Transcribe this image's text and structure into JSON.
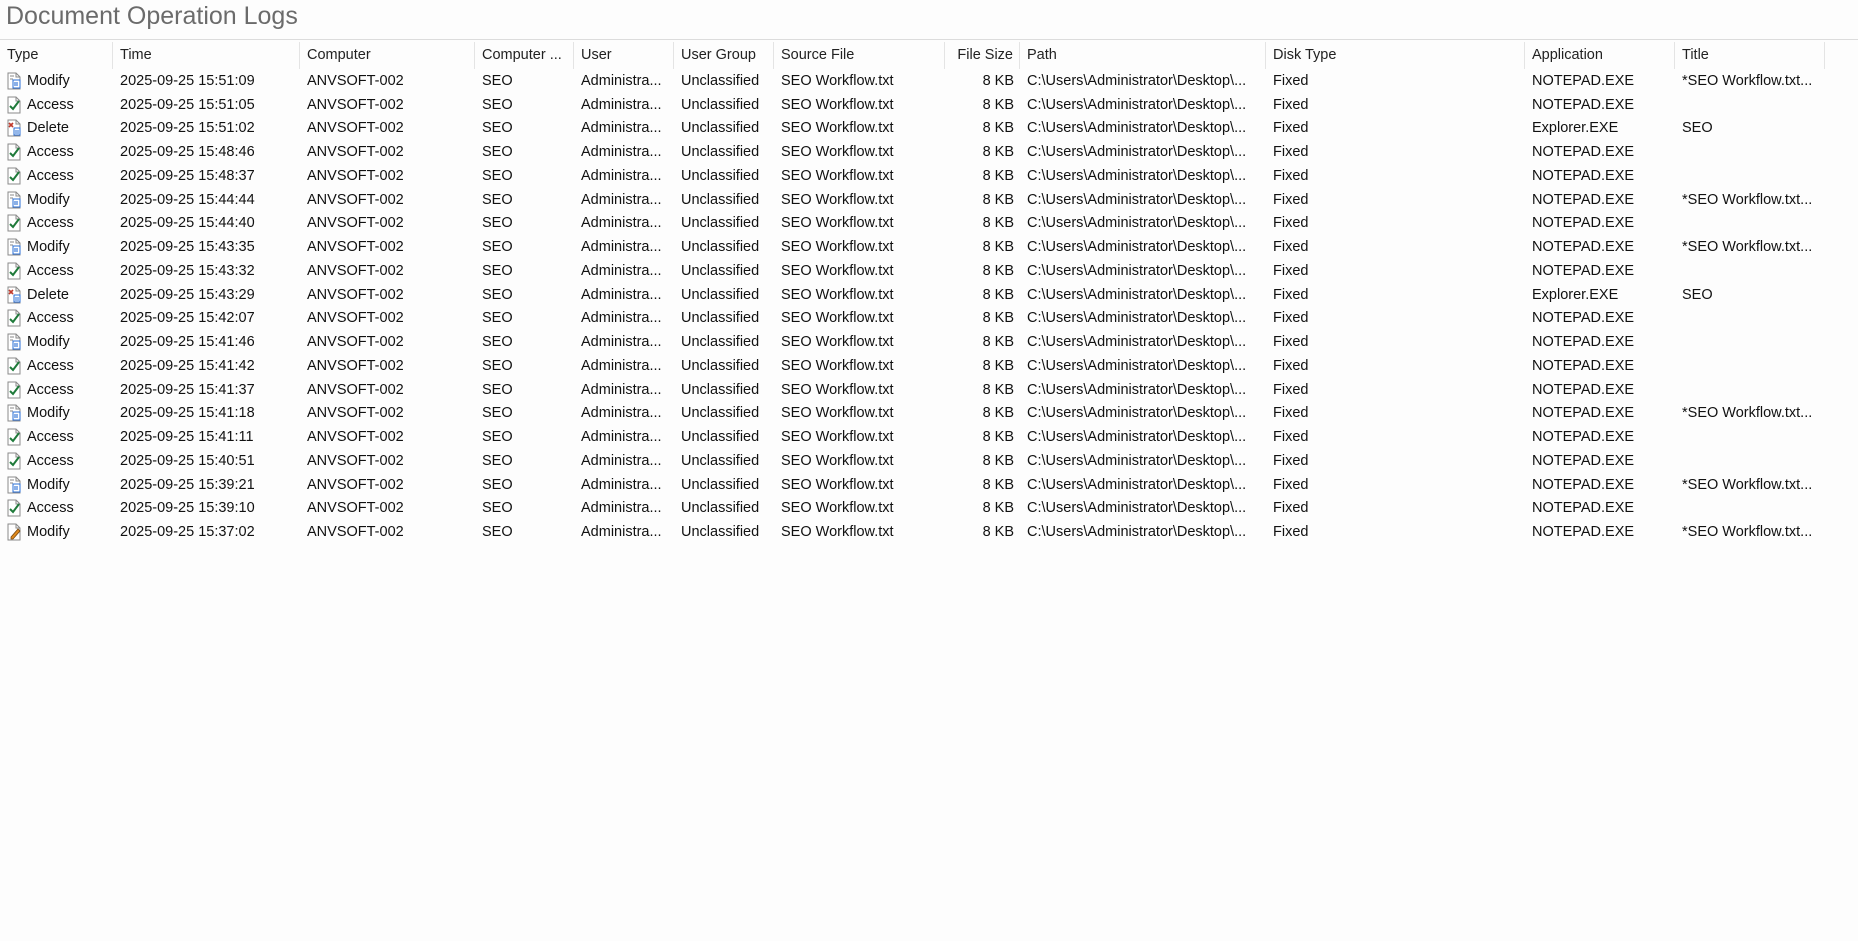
{
  "page_title": "Document Operation Logs",
  "columns": {
    "type": "Type",
    "time": "Time",
    "computer": "Computer",
    "computer_group": "Computer ...",
    "user": "User",
    "user_group": "User Group",
    "source_file": "Source File",
    "file_size": "File Size",
    "path": "Path",
    "disk_type": "Disk Type",
    "application": "Application",
    "title": "Title"
  },
  "icons": {
    "Modify": "modify-icon",
    "Access": "access-icon",
    "Delete": "delete-icon"
  },
  "colors": {
    "check": "#1f7a3a",
    "delete_red": "#c0392b",
    "modify_blue": "#2a6fd6",
    "pencil": "#e08a1e"
  },
  "rows": [
    {
      "type": "Modify",
      "time": "2025-09-25 15:51:09",
      "computer": "ANVSOFT-002",
      "group": "SEO",
      "user": "Administra...",
      "ugroup": "Unclassified",
      "src": "SEO Workflow.txt",
      "size": "8 KB",
      "path": "C:\\Users\\Administrator\\Desktop\\...",
      "disk": "Fixed",
      "app": "NOTEPAD.EXE",
      "title": "*SEO Workflow.txt..."
    },
    {
      "type": "Access",
      "time": "2025-09-25 15:51:05",
      "computer": "ANVSOFT-002",
      "group": "SEO",
      "user": "Administra...",
      "ugroup": "Unclassified",
      "src": "SEO Workflow.txt",
      "size": "8 KB",
      "path": "C:\\Users\\Administrator\\Desktop\\...",
      "disk": "Fixed",
      "app": "NOTEPAD.EXE",
      "title": ""
    },
    {
      "type": "Delete",
      "time": "2025-09-25 15:51:02",
      "computer": "ANVSOFT-002",
      "group": "SEO",
      "user": "Administra...",
      "ugroup": "Unclassified",
      "src": "SEO Workflow.txt",
      "size": "8 KB",
      "path": "C:\\Users\\Administrator\\Desktop\\...",
      "disk": "Fixed",
      "app": "Explorer.EXE",
      "title": "SEO"
    },
    {
      "type": "Access",
      "time": "2025-09-25 15:48:46",
      "computer": "ANVSOFT-002",
      "group": "SEO",
      "user": "Administra...",
      "ugroup": "Unclassified",
      "src": "SEO Workflow.txt",
      "size": "8 KB",
      "path": "C:\\Users\\Administrator\\Desktop\\...",
      "disk": "Fixed",
      "app": "NOTEPAD.EXE",
      "title": ""
    },
    {
      "type": "Access",
      "time": "2025-09-25 15:48:37",
      "computer": "ANVSOFT-002",
      "group": "SEO",
      "user": "Administra...",
      "ugroup": "Unclassified",
      "src": "SEO Workflow.txt",
      "size": "8 KB",
      "path": "C:\\Users\\Administrator\\Desktop\\...",
      "disk": "Fixed",
      "app": "NOTEPAD.EXE",
      "title": ""
    },
    {
      "type": "Modify",
      "time": "2025-09-25 15:44:44",
      "computer": "ANVSOFT-002",
      "group": "SEO",
      "user": "Administra...",
      "ugroup": "Unclassified",
      "src": "SEO Workflow.txt",
      "size": "8 KB",
      "path": "C:\\Users\\Administrator\\Desktop\\...",
      "disk": "Fixed",
      "app": "NOTEPAD.EXE",
      "title": "*SEO Workflow.txt..."
    },
    {
      "type": "Access",
      "time": "2025-09-25 15:44:40",
      "computer": "ANVSOFT-002",
      "group": "SEO",
      "user": "Administra...",
      "ugroup": "Unclassified",
      "src": "SEO Workflow.txt",
      "size": "8 KB",
      "path": "C:\\Users\\Administrator\\Desktop\\...",
      "disk": "Fixed",
      "app": "NOTEPAD.EXE",
      "title": ""
    },
    {
      "type": "Modify",
      "time": "2025-09-25 15:43:35",
      "computer": "ANVSOFT-002",
      "group": "SEO",
      "user": "Administra...",
      "ugroup": "Unclassified",
      "src": "SEO Workflow.txt",
      "size": "8 KB",
      "path": "C:\\Users\\Administrator\\Desktop\\...",
      "disk": "Fixed",
      "app": "NOTEPAD.EXE",
      "title": "*SEO Workflow.txt..."
    },
    {
      "type": "Access",
      "time": "2025-09-25 15:43:32",
      "computer": "ANVSOFT-002",
      "group": "SEO",
      "user": "Administra...",
      "ugroup": "Unclassified",
      "src": "SEO Workflow.txt",
      "size": "8 KB",
      "path": "C:\\Users\\Administrator\\Desktop\\...",
      "disk": "Fixed",
      "app": "NOTEPAD.EXE",
      "title": ""
    },
    {
      "type": "Delete",
      "time": "2025-09-25 15:43:29",
      "computer": "ANVSOFT-002",
      "group": "SEO",
      "user": "Administra...",
      "ugroup": "Unclassified",
      "src": "SEO Workflow.txt",
      "size": "8 KB",
      "path": "C:\\Users\\Administrator\\Desktop\\...",
      "disk": "Fixed",
      "app": "Explorer.EXE",
      "title": "SEO"
    },
    {
      "type": "Access",
      "time": "2025-09-25 15:42:07",
      "computer": "ANVSOFT-002",
      "group": "SEO",
      "user": "Administra...",
      "ugroup": "Unclassified",
      "src": "SEO Workflow.txt",
      "size": "8 KB",
      "path": "C:\\Users\\Administrator\\Desktop\\...",
      "disk": "Fixed",
      "app": "NOTEPAD.EXE",
      "title": ""
    },
    {
      "type": "Modify",
      "time": "2025-09-25 15:41:46",
      "computer": "ANVSOFT-002",
      "group": "SEO",
      "user": "Administra...",
      "ugroup": "Unclassified",
      "src": "SEO Workflow.txt",
      "size": "8 KB",
      "path": "C:\\Users\\Administrator\\Desktop\\...",
      "disk": "Fixed",
      "app": "NOTEPAD.EXE",
      "title": ""
    },
    {
      "type": "Access",
      "time": "2025-09-25 15:41:42",
      "computer": "ANVSOFT-002",
      "group": "SEO",
      "user": "Administra...",
      "ugroup": "Unclassified",
      "src": "SEO Workflow.txt",
      "size": "8 KB",
      "path": "C:\\Users\\Administrator\\Desktop\\...",
      "disk": "Fixed",
      "app": "NOTEPAD.EXE",
      "title": ""
    },
    {
      "type": "Access",
      "time": "2025-09-25 15:41:37",
      "computer": "ANVSOFT-002",
      "group": "SEO",
      "user": "Administra...",
      "ugroup": "Unclassified",
      "src": "SEO Workflow.txt",
      "size": "8 KB",
      "path": "C:\\Users\\Administrator\\Desktop\\...",
      "disk": "Fixed",
      "app": "NOTEPAD.EXE",
      "title": ""
    },
    {
      "type": "Modify",
      "time": "2025-09-25 15:41:18",
      "computer": "ANVSOFT-002",
      "group": "SEO",
      "user": "Administra...",
      "ugroup": "Unclassified",
      "src": "SEO Workflow.txt",
      "size": "8 KB",
      "path": "C:\\Users\\Administrator\\Desktop\\...",
      "disk": "Fixed",
      "app": "NOTEPAD.EXE",
      "title": "*SEO Workflow.txt..."
    },
    {
      "type": "Access",
      "time": "2025-09-25 15:41:11",
      "computer": "ANVSOFT-002",
      "group": "SEO",
      "user": "Administra...",
      "ugroup": "Unclassified",
      "src": "SEO Workflow.txt",
      "size": "8 KB",
      "path": "C:\\Users\\Administrator\\Desktop\\...",
      "disk": "Fixed",
      "app": "NOTEPAD.EXE",
      "title": ""
    },
    {
      "type": "Access",
      "time": "2025-09-25 15:40:51",
      "computer": "ANVSOFT-002",
      "group": "SEO",
      "user": "Administra...",
      "ugroup": "Unclassified",
      "src": "SEO Workflow.txt",
      "size": "8 KB",
      "path": "C:\\Users\\Administrator\\Desktop\\...",
      "disk": "Fixed",
      "app": "NOTEPAD.EXE",
      "title": ""
    },
    {
      "type": "Modify",
      "time": "2025-09-25 15:39:21",
      "computer": "ANVSOFT-002",
      "group": "SEO",
      "user": "Administra...",
      "ugroup": "Unclassified",
      "src": "SEO Workflow.txt",
      "size": "8 KB",
      "path": "C:\\Users\\Administrator\\Desktop\\...",
      "disk": "Fixed",
      "app": "NOTEPAD.EXE",
      "title": "*SEO Workflow.txt..."
    },
    {
      "type": "Access",
      "time": "2025-09-25 15:39:10",
      "computer": "ANVSOFT-002",
      "group": "SEO",
      "user": "Administra...",
      "ugroup": "Unclassified",
      "src": "SEO Workflow.txt",
      "size": "8 KB",
      "path": "C:\\Users\\Administrator\\Desktop\\...",
      "disk": "Fixed",
      "app": "NOTEPAD.EXE",
      "title": ""
    },
    {
      "type": "Modify",
      "time": "2025-09-25 15:37:02",
      "computer": "ANVSOFT-002",
      "group": "SEO",
      "user": "Administra...",
      "ugroup": "Unclassified",
      "src": "SEO Workflow.txt",
      "size": "8 KB",
      "path": "C:\\Users\\Administrator\\Desktop\\...",
      "disk": "Fixed",
      "app": "NOTEPAD.EXE",
      "title": "*SEO Workflow.txt...",
      "icon_variant": "pencil"
    }
  ]
}
